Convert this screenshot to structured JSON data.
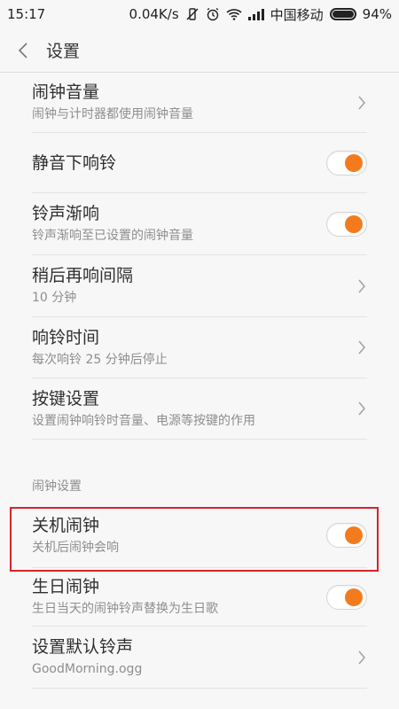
{
  "status_bar": {
    "time": "15:17",
    "speed": "0.04K/s",
    "carrier": "中国移动",
    "battery": "94%"
  },
  "header": {
    "title": "设置"
  },
  "items": [
    {
      "title": "闹钟音量",
      "subtitle": "闹钟与计时器都使用闹钟音量",
      "control": "chevron"
    },
    {
      "title": "静音下响铃",
      "subtitle": "",
      "control": "toggle",
      "on": true
    },
    {
      "title": "铃声渐响",
      "subtitle": "铃声渐响至已设置的闹钟音量",
      "control": "toggle",
      "on": true
    },
    {
      "title": "稍后再响间隔",
      "subtitle": "10 分钟",
      "control": "chevron"
    },
    {
      "title": "响铃时间",
      "subtitle": "每次响铃 25 分钟后停止",
      "control": "chevron"
    },
    {
      "title": "按键设置",
      "subtitle": "设置闹钟响铃时音量、电源等按键的作用",
      "control": "chevron"
    }
  ],
  "section": {
    "label": "闹钟设置",
    "items": [
      {
        "title": "关机闹钟",
        "subtitle": "关机后闹钟会响",
        "control": "toggle",
        "on": true
      },
      {
        "title": "生日闹钟",
        "subtitle": "生日当天的闹钟铃声替换为生日歌",
        "control": "toggle",
        "on": true
      },
      {
        "title": "设置默认铃声",
        "subtitle": "GoodMorning.ogg",
        "control": "chevron"
      }
    ]
  },
  "colors": {
    "accent": "#f37b1d",
    "highlight": "#d6242b"
  }
}
